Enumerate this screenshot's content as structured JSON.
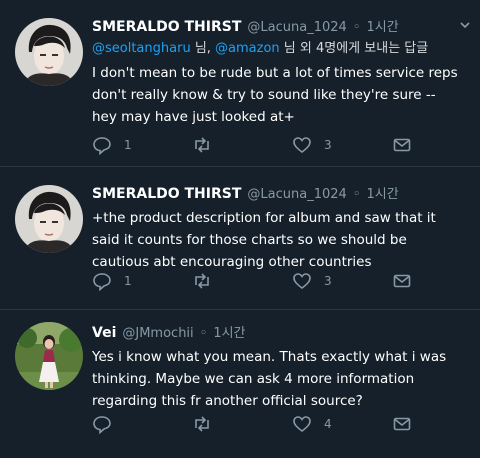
{
  "tweets": [
    {
      "display_name": "SMERALDO THIRST",
      "handle": "@Lacuna_1024",
      "separator": "◦",
      "time": "1시간",
      "reply_prefix": "",
      "mentions": [
        "@seoltangharu",
        "@amazon"
      ],
      "reply_joiner": " 님, ",
      "reply_suffix": " 님 외 4명에게 보내는 답글",
      "text": "I don't mean to be rude but a lot of times service reps don't really know & try to sound like they're sure -- hey may have just looked at+",
      "replies": "1",
      "retweets": "",
      "likes": "3",
      "avatar": "avatar-dark-hair-man"
    },
    {
      "display_name": "SMERALDO THIRST",
      "handle": "@Lacuna_1024",
      "separator": "◦",
      "time": "1시간",
      "text": "+the product description for album and saw that it said it counts for those charts so we should be cautious abt encouraging other countries",
      "replies": "1",
      "retweets": "",
      "likes": "3",
      "avatar": "avatar-dark-hair-man"
    },
    {
      "display_name": "Vei",
      "handle": "@JMmochii",
      "separator": "◦",
      "time": "1시간",
      "text": "Yes i know what you mean. Thats exactly what i was thinking. Maybe we can ask 4 more information regarding this fr another official source?",
      "replies": "",
      "retweets": "",
      "likes": "4",
      "avatar": "avatar-woman-outdoor"
    }
  ],
  "icons": {
    "reply": "reply-icon",
    "retweet": "retweet-icon",
    "like": "heart-icon",
    "share": "mail-icon",
    "caret": "chevron-down-icon"
  },
  "colors": {
    "background": "#15202b",
    "link": "#1da1f2",
    "secondary_text": "#8899a6",
    "primary_text": "#ffffff",
    "divider": "#2a3744"
  }
}
